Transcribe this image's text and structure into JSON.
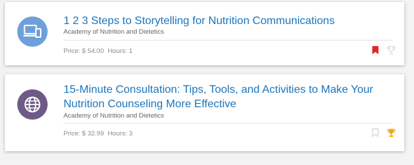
{
  "courses": [
    {
      "title": "1 2 3 Steps to Storytelling for Nutrition Communications",
      "organization": "Academy of Nutrition and Dietetics",
      "price_label": "Price: $ 54.00",
      "hours_label": "Hours: 1",
      "icon": "devices-icon",
      "icon_color": "#6f9fd8",
      "bookmarked": true,
      "completed": false
    },
    {
      "title": "15-Minute Consultation: Tips, Tools, and Activities to Make Your Nutrition Counseling More Effective",
      "organization": "Academy of Nutrition and Dietetics",
      "price_label": "Price: $ 32.99",
      "hours_label": "Hours: 3",
      "icon": "globe-icon",
      "icon_color": "#6e5a86",
      "bookmarked": false,
      "completed": true
    }
  ],
  "colors": {
    "title": "#1b75bb",
    "bookmark_active": "#e32626",
    "trophy_active": "#f2a900",
    "icon_inactive": "#d8d8d8"
  }
}
